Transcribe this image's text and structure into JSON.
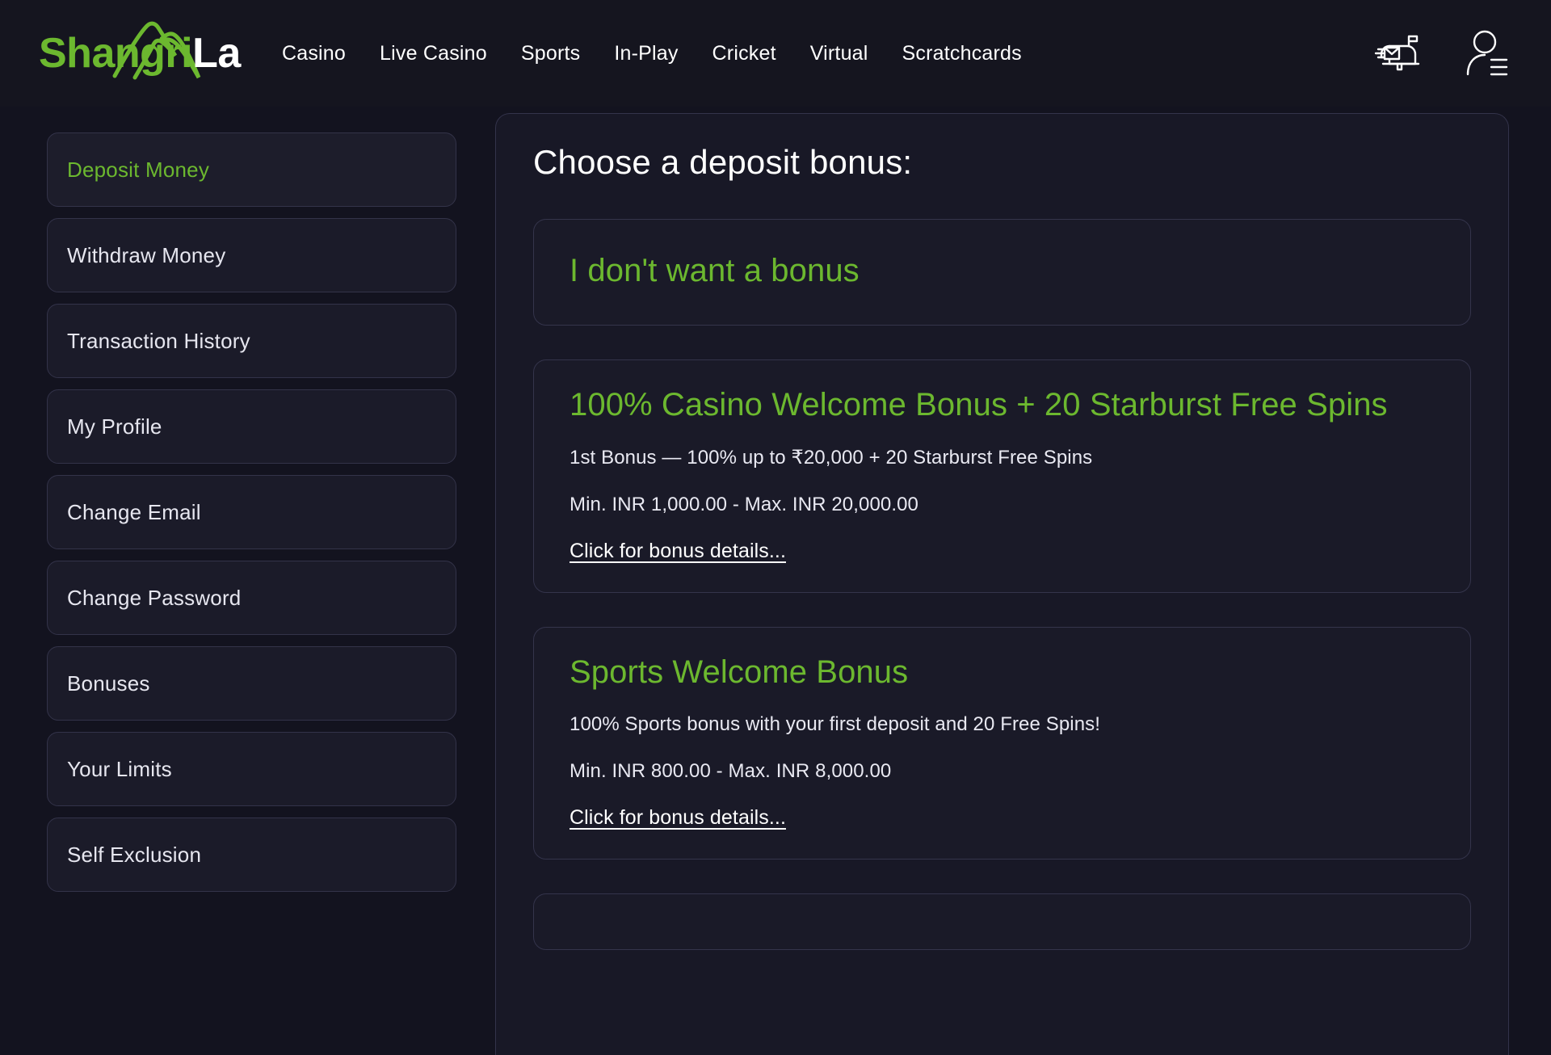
{
  "header": {
    "logo": {
      "part1": "Shangri",
      "part2": "La",
      "icon": "mountain-icon"
    },
    "nav": [
      {
        "label": "Casino"
      },
      {
        "label": "Live Casino"
      },
      {
        "label": "Sports"
      },
      {
        "label": "In-Play"
      },
      {
        "label": "Cricket"
      },
      {
        "label": "Virtual"
      },
      {
        "label": "Scratchcards"
      }
    ],
    "icons": [
      {
        "name": "mailbox-icon"
      },
      {
        "name": "user-account-menu-icon"
      }
    ]
  },
  "sidebar": {
    "items": [
      {
        "label": "Deposit Money",
        "active": true
      },
      {
        "label": "Withdraw Money",
        "active": false
      },
      {
        "label": "Transaction History",
        "active": false
      },
      {
        "label": "My Profile",
        "active": false
      },
      {
        "label": "Change Email",
        "active": false
      },
      {
        "label": "Change Password",
        "active": false
      },
      {
        "label": "Bonuses",
        "active": false
      },
      {
        "label": "Your Limits",
        "active": false
      },
      {
        "label": "Self Exclusion",
        "active": false
      }
    ]
  },
  "main": {
    "title": "Choose a deposit bonus:",
    "bonuses": [
      {
        "title": "I don't want a bonus",
        "description": "",
        "limits": "",
        "details_link": ""
      },
      {
        "title": "100% Casino Welcome Bonus + 20 Starburst Free Spins",
        "description": "1st Bonus — 100% up to ₹20,000 + 20 Starburst Free Spins",
        "limits": "Min. INR 1,000.00  -  Max. INR 20,000.00",
        "details_link": "Click for bonus details..."
      },
      {
        "title": "Sports Welcome Bonus",
        "description": "100% Sports bonus with your first deposit and 20 Free Spins!",
        "limits": "Min. INR 800.00  -  Max. INR 8,000.00",
        "details_link": "Click for bonus details..."
      }
    ]
  },
  "colors": {
    "accent_green": "#6cb82f",
    "page_background": "#13131f",
    "card_background": "#1a1a28",
    "card_border": "#34344b",
    "text_primary": "#ffffff"
  }
}
